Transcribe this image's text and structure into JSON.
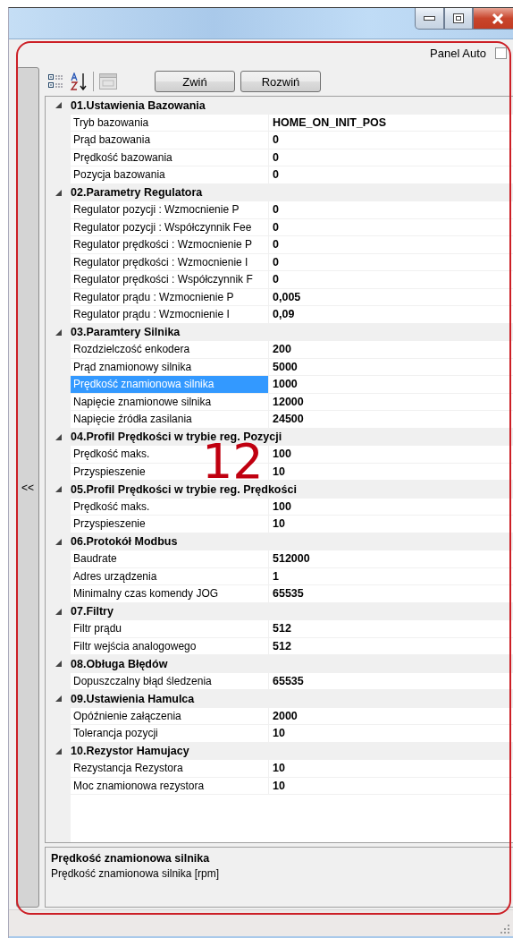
{
  "panel_auto": {
    "label": "Panel Auto",
    "checked": false
  },
  "side_panel": {
    "toggle": "<<"
  },
  "toolbar": {
    "buttons": [
      "Zwiń",
      "Rozwiń"
    ]
  },
  "categories": [
    {
      "title": "01.Ustawienia Bazowania",
      "expanded": true,
      "properties": [
        {
          "name": "Tryb bazowania",
          "value": "HOME_ON_INIT_POS",
          "selected": false
        },
        {
          "name": "Prąd bazowania",
          "value": "0",
          "selected": false
        },
        {
          "name": "Prędkość bazowania",
          "value": "0",
          "selected": false
        },
        {
          "name": "Pozycja bazowania",
          "value": "0",
          "selected": false
        }
      ]
    },
    {
      "title": "02.Parametry Regulatora",
      "expanded": true,
      "properties": [
        {
          "name": "Regulator pozycji : Wzmocnienie P",
          "value": "0",
          "selected": false
        },
        {
          "name": "Regulator pozycji : Współczynnik Fee",
          "value": "0",
          "selected": false
        },
        {
          "name": "Regulator prędkości : Wzmocnienie P",
          "value": "0",
          "selected": false
        },
        {
          "name": "Regulator prędkości : Wzmocnienie I",
          "value": "0",
          "selected": false
        },
        {
          "name": "Regulator prędkości : Współczynnik F",
          "value": "0",
          "selected": false
        },
        {
          "name": "Regulator prądu : Wzmocnienie P",
          "value": "0,005",
          "selected": false
        },
        {
          "name": "Regulator prądu : Wzmocnienie I",
          "value": "0,09",
          "selected": false
        }
      ]
    },
    {
      "title": "03.Paramtery Silnika",
      "expanded": true,
      "properties": [
        {
          "name": "Rozdzielczość enkodera",
          "value": "200",
          "selected": false
        },
        {
          "name": "Prąd znamionowy silnika",
          "value": "5000",
          "selected": false
        },
        {
          "name": "Prędkość znamionowa silnika",
          "value": "1000",
          "selected": true
        },
        {
          "name": "Napięcie znamionowe silnika",
          "value": "12000",
          "selected": false
        },
        {
          "name": "Napięcie źródła zasilania",
          "value": "24500",
          "selected": false
        }
      ]
    },
    {
      "title": "04.Profil Prędkości w trybie reg. Pozycji",
      "expanded": true,
      "properties": [
        {
          "name": "Prędkość maks.",
          "value": "100",
          "selected": false
        },
        {
          "name": "Przyspieszenie",
          "value": "10",
          "selected": false
        }
      ]
    },
    {
      "title": "05.Profil Prędkości w trybie reg. Prędkości",
      "expanded": true,
      "properties": [
        {
          "name": "Prędkość maks.",
          "value": "100",
          "selected": false
        },
        {
          "name": "Przyspieszenie",
          "value": "10",
          "selected": false
        }
      ]
    },
    {
      "title": "06.Protokół Modbus",
      "expanded": true,
      "properties": [
        {
          "name": "Baudrate",
          "value": "512000",
          "selected": false
        },
        {
          "name": "Adres urządzenia",
          "value": "1",
          "selected": false
        },
        {
          "name": "Minimalny czas komendy JOG",
          "value": "65535",
          "selected": false
        }
      ]
    },
    {
      "title": "07.Filtry",
      "expanded": true,
      "properties": [
        {
          "name": "Filtr prądu",
          "value": "512",
          "selected": false
        },
        {
          "name": "Filtr wejścia analogowego",
          "value": "512",
          "selected": false
        }
      ]
    },
    {
      "title": "08.Obługa Błędów",
      "expanded": true,
      "properties": [
        {
          "name": "Dopuszczalny błąd śledzenia",
          "value": "65535",
          "selected": false
        }
      ]
    },
    {
      "title": "09.Ustawienia Hamulca",
      "expanded": true,
      "properties": [
        {
          "name": "Opóźnienie załączenia",
          "value": "2000",
          "selected": false
        },
        {
          "name": "Tolerancja pozycji",
          "value": "10",
          "selected": false
        }
      ]
    },
    {
      "title": "10.Rezystor Hamujacy",
      "expanded": true,
      "properties": [
        {
          "name": "Rezystancja Rezystora",
          "value": "10",
          "selected": false
        },
        {
          "name": "Moc znamionowa rezystora",
          "value": "10",
          "selected": false
        }
      ]
    }
  ],
  "description": {
    "title": "Prędkość znamionowa silnika",
    "text": "Prędkość znamionowa silnika [rpm]"
  },
  "annotation": {
    "label": "12"
  }
}
